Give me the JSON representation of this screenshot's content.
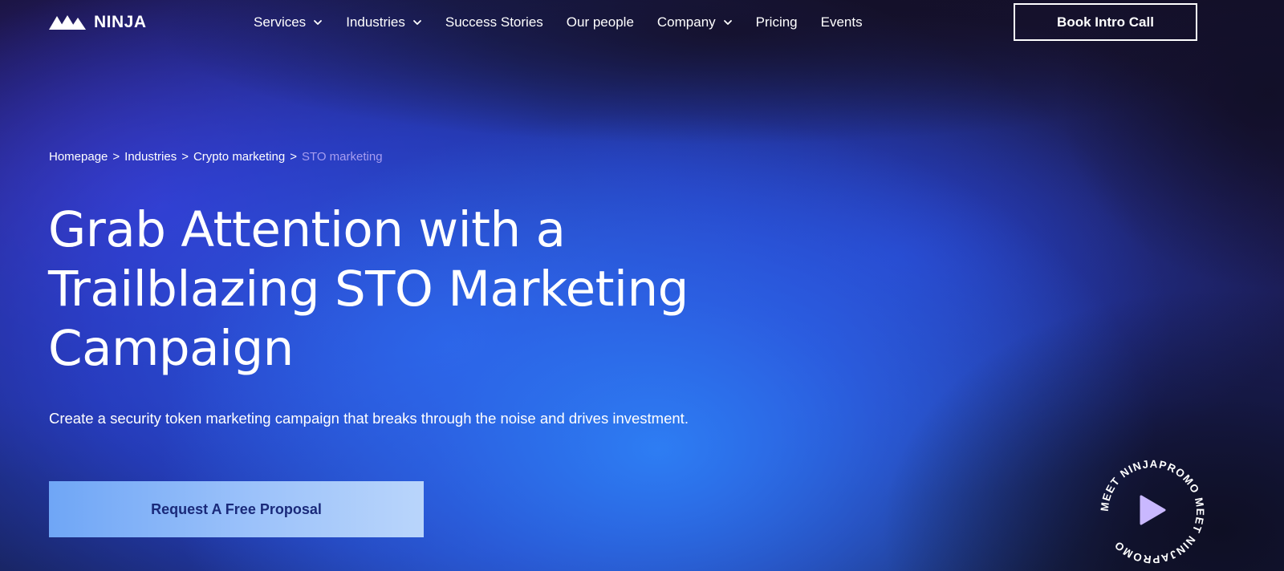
{
  "header": {
    "logo_text": "NINJA",
    "nav": [
      {
        "label": "Services",
        "has_dropdown": true
      },
      {
        "label": "Industries",
        "has_dropdown": true
      },
      {
        "label": "Success Stories",
        "has_dropdown": false
      },
      {
        "label": "Our people",
        "has_dropdown": false
      },
      {
        "label": "Company",
        "has_dropdown": true
      },
      {
        "label": "Pricing",
        "has_dropdown": false
      },
      {
        "label": "Events",
        "has_dropdown": false
      }
    ],
    "cta_label": "Book Intro Call"
  },
  "breadcrumb": {
    "items": [
      "Homepage",
      "Industries",
      "Crypto marketing"
    ],
    "current": "STO marketing",
    "separator": ">"
  },
  "hero": {
    "title_lines": [
      "Grab Attention with a",
      "Trailblazing STO Marketing",
      "Campaign"
    ],
    "subtitle": "Create a security token marketing campaign that breaks through the noise and drives investment.",
    "cta_label": "Request A Free Proposal"
  },
  "video_badge": {
    "ring_text": "MEET NINJAPROMO MEET NINJAPROMO ",
    "icon": "play-icon"
  },
  "colors": {
    "breadcrumb_current": "#a79df0",
    "cta_text": "#1a2a7a",
    "play_icon": "#c9b8ff"
  }
}
